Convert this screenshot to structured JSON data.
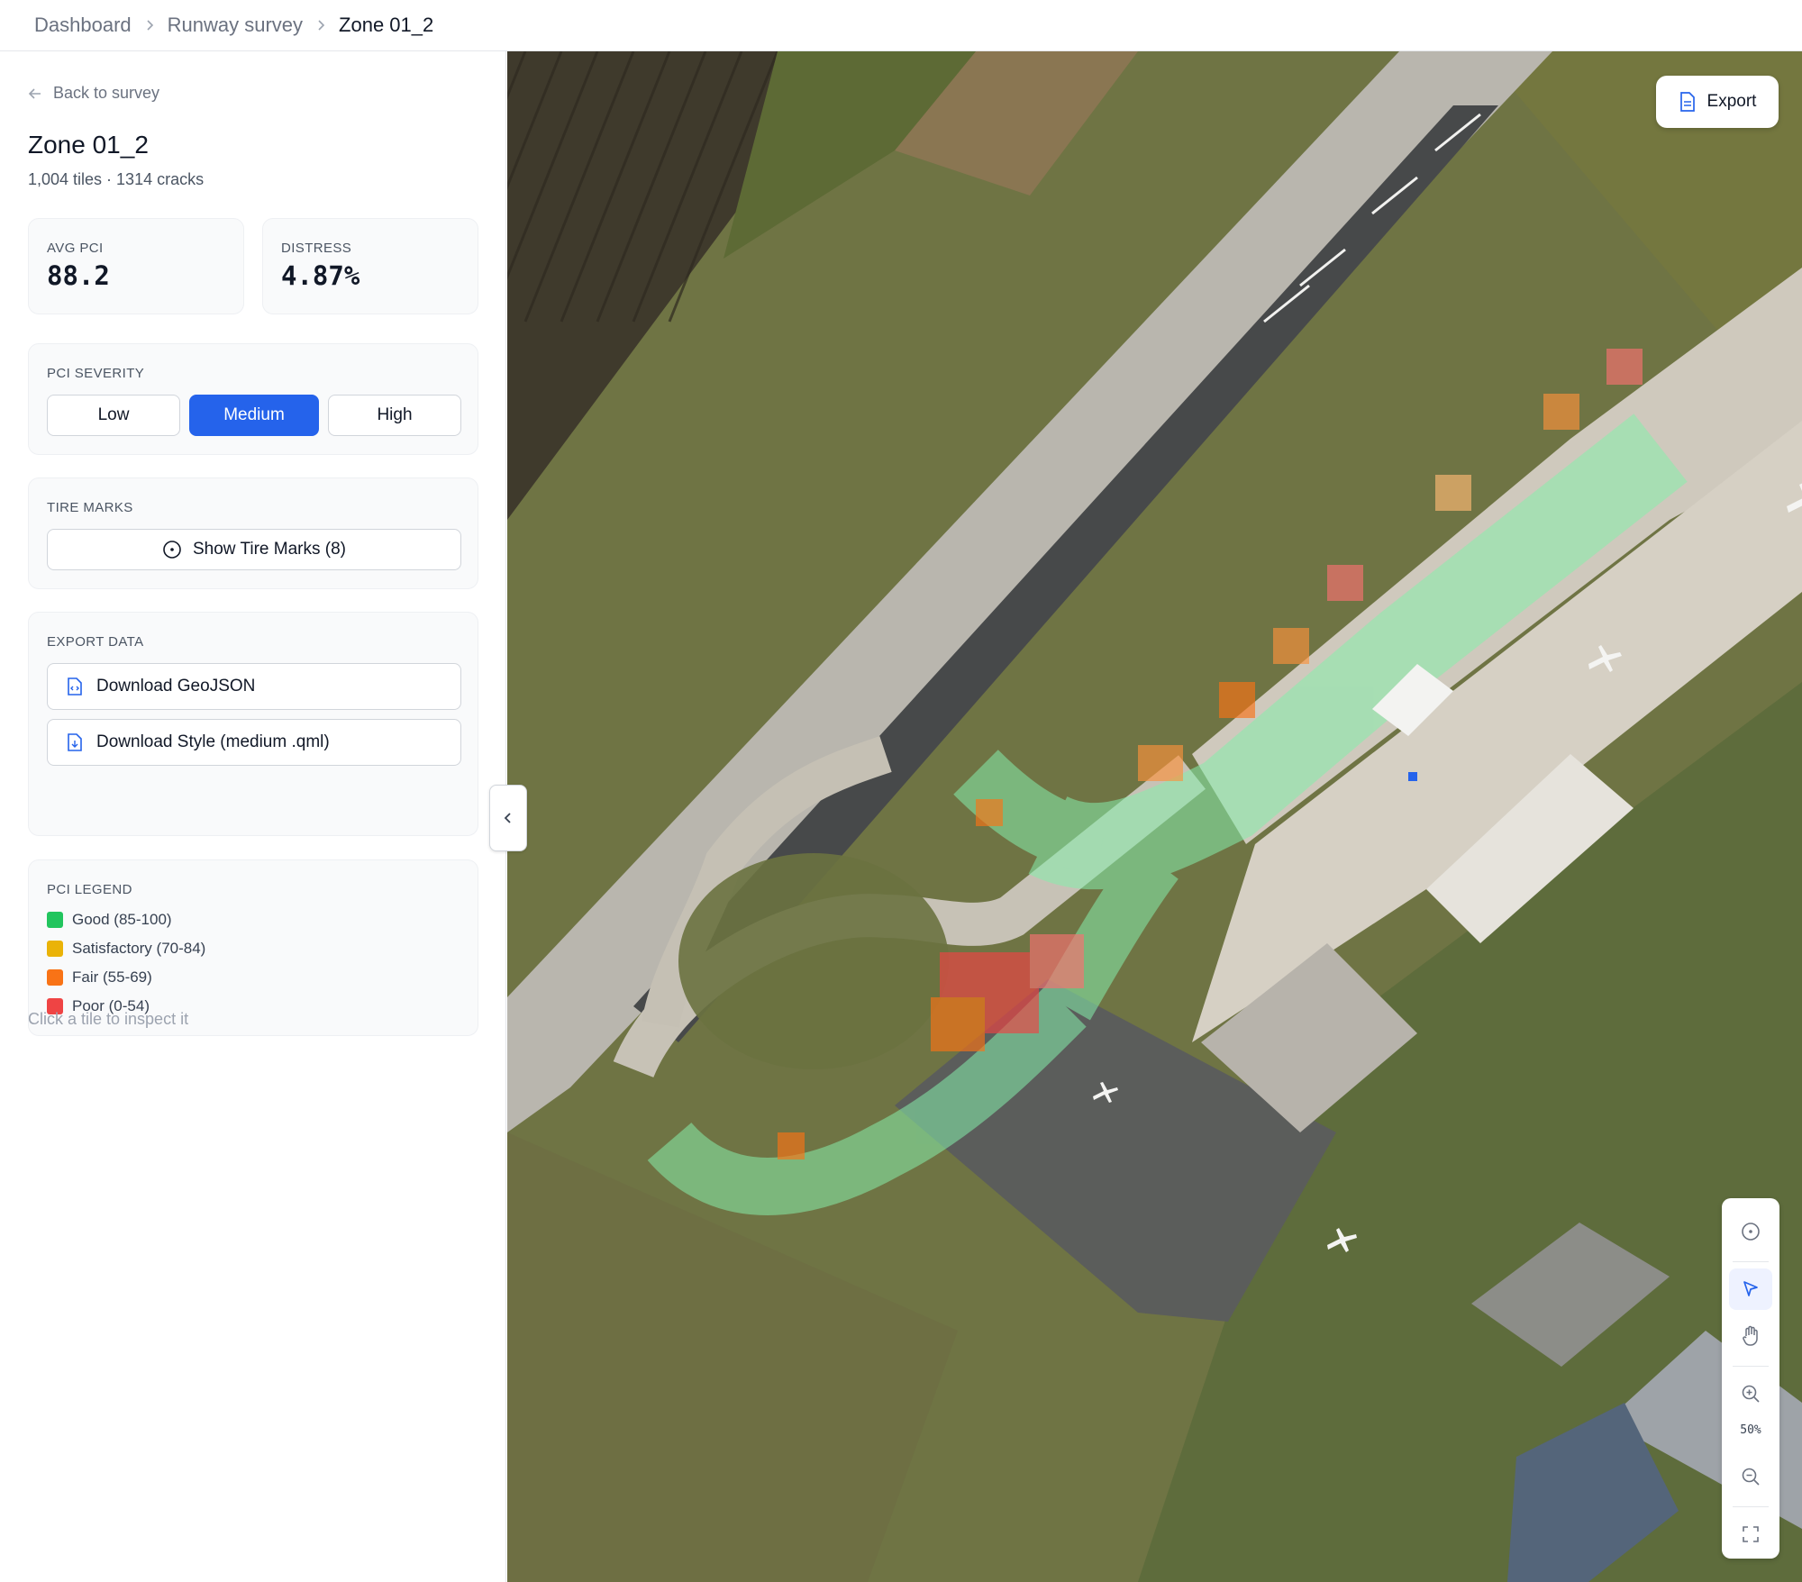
{
  "breadcrumb": [
    "Dashboard",
    "Runway survey",
    "Zone 01_2"
  ],
  "sidebar": {
    "back_label": "Back to survey",
    "title": "Zone 01_2",
    "subtitle": "1,004 tiles · 1314 cracks",
    "metrics": [
      {
        "label": "AVG PCI",
        "value": "88.2"
      },
      {
        "label": "DISTRESS",
        "value": "4.87%"
      }
    ],
    "severity": {
      "label": "PCI SEVERITY",
      "options": [
        "Low",
        "Medium",
        "High"
      ],
      "selected": "Medium"
    },
    "tire_marks": {
      "label": "TIRE MARKS",
      "button": "Show Tire Marks (8)"
    },
    "export": {
      "label": "EXPORT DATA",
      "geojson": "Download GeoJSON",
      "style": "Download Style (medium .qml)"
    },
    "legend": {
      "label": "PCI LEGEND",
      "items": [
        {
          "label": "Good (85-100)",
          "color": "#22c55e"
        },
        {
          "label": "Satisfactory (70-84)",
          "color": "#eab308"
        },
        {
          "label": "Fair (55-69)",
          "color": "#f97316"
        },
        {
          "label": "Poor (0-54)",
          "color": "#ef4444"
        }
      ]
    },
    "hint": "Click a tile to inspect it"
  },
  "map": {
    "export_label": "Export",
    "zoom": "50%",
    "tools": [
      "target-icon",
      "select-pointer-icon",
      "pan-hand-icon",
      "zoom-in-icon",
      "zoom-out-icon",
      "fullscreen-icon"
    ],
    "active_tool": "select-pointer-icon"
  },
  "colors": {
    "accent": "#2563eb"
  }
}
